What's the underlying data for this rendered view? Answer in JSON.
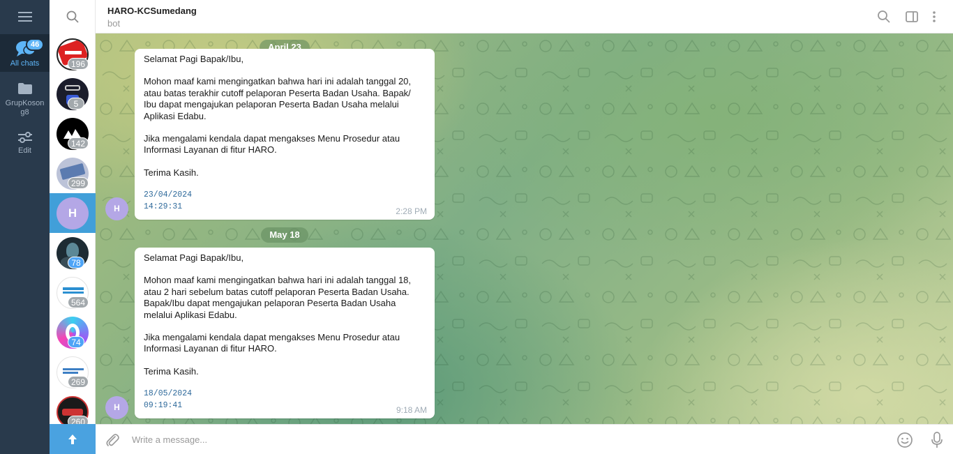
{
  "rail": {
    "folders": [
      {
        "label": "All chats",
        "badge": "46"
      },
      {
        "label": "GrupKoson g8"
      },
      {
        "label": "Edit"
      }
    ]
  },
  "chat_list": [
    {
      "unread": "196",
      "tone": "gray"
    },
    {
      "unread": "5",
      "tone": "gray"
    },
    {
      "unread": "142",
      "tone": "gray"
    },
    {
      "unread": "299",
      "tone": "gray"
    },
    {
      "initial": "H",
      "active": true
    },
    {
      "unread": "78",
      "tone": "blue"
    },
    {
      "unread": "564",
      "tone": "gray"
    },
    {
      "unread": "74",
      "tone": "blue"
    },
    {
      "unread": "269",
      "tone": "gray"
    },
    {
      "unread": "260",
      "tone": "gray"
    }
  ],
  "header": {
    "title": "HARO-KCSumedang",
    "subtitle": "bot"
  },
  "messages": [
    {
      "date": "April 23",
      "avatar_initial": "H",
      "lines": [
        "Selamat Pagi Bapak/Ibu,",
        "",
        "Mohon maaf kami mengingatkan bahwa hari ini adalah tanggal 20,",
        "atau batas terakhir cutoff pelaporan Peserta Badan Usaha. Bapak/",
        "Ibu dapat mengajukan pelaporan Peserta Badan Usaha melalui",
        "Aplikasi Edabu.",
        "",
        "Jika mengalami kendala dapat mengakses Menu Prosedur atau",
        "Informasi Layanan di fitur HARO.",
        "",
        "Terima Kasih.",
        ""
      ],
      "stamp_date": "23/04/2024",
      "stamp_time": "14:29:31",
      "time": "2:28 PM"
    },
    {
      "date": "May 18",
      "avatar_initial": "H",
      "lines": [
        "Selamat Pagi Bapak/Ibu,",
        "",
        "Mohon maaf kami mengingatkan bahwa hari ini adalah tanggal 18,",
        "atau 2 hari sebelum batas cutoff pelaporan Peserta Badan Usaha.",
        "Bapak/Ibu dapat mengajukan pelaporan Peserta Badan Usaha",
        "melalui Aplikasi Edabu.",
        "",
        "Jika mengalami kendala dapat mengakses Menu Prosedur atau",
        "Informasi Layanan di fitur HARO.",
        "",
        "Terima Kasih.",
        ""
      ],
      "stamp_date": "18/05/2024",
      "stamp_time": "09:19:41",
      "time": "9:18 AM"
    }
  ],
  "composer": {
    "placeholder": "Write a message..."
  },
  "colors": {
    "rail_bg": "#293a4c",
    "accent": "#419fd9",
    "unread_gray": "#a3a9ad",
    "unread_blue": "#4ea4f6"
  },
  "icons": [
    "menu-icon",
    "chat-bubbles-icon",
    "folder-icon",
    "sliders-icon",
    "search-icon",
    "sidebar-toggle-icon",
    "more-vertical-icon",
    "arrow-up-icon",
    "paperclip-icon",
    "emoji-icon",
    "microphone-icon"
  ]
}
